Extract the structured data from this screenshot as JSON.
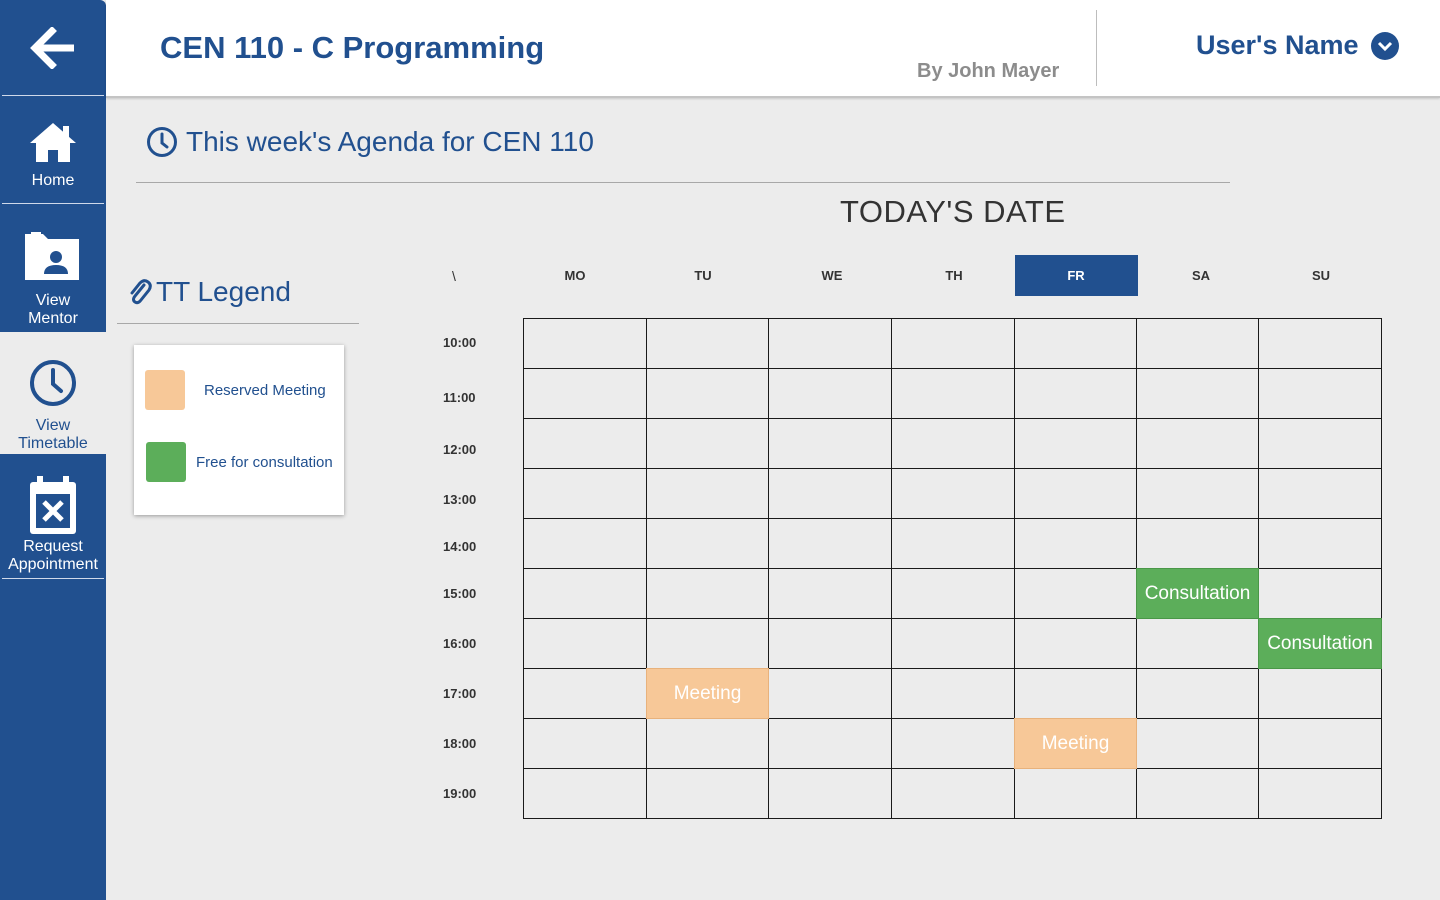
{
  "nav": {
    "back_icon": "arrow-left-icon",
    "items": [
      {
        "id": "home",
        "label": "Home",
        "icon": "home-icon"
      },
      {
        "id": "mentor",
        "label": "View\nMentor",
        "icon": "folder-user-icon"
      },
      {
        "id": "timetable",
        "label": "View\nTimetable",
        "icon": "clock-icon",
        "active": true
      },
      {
        "id": "appointment",
        "label": "Request\nAppointment",
        "icon": "calendar-x-icon"
      }
    ]
  },
  "header": {
    "course_title": "CEN 110 - C Programming",
    "author": "By John Mayer",
    "user_name": "User's Name"
  },
  "agenda": {
    "title": "This week's Agenda for CEN 110",
    "today_label": "TODAY'S DATE"
  },
  "legend": {
    "title": "TT Legend",
    "items": [
      {
        "label": "Reserved Meeting",
        "color": "#f7c898"
      },
      {
        "label": "Free for consultation",
        "color": "#5cae5a"
      }
    ]
  },
  "timetable": {
    "corner": "\\",
    "days": [
      "MO",
      "TU",
      "WE",
      "TH",
      "FR",
      "SA",
      "SU"
    ],
    "active_day": "FR",
    "times": [
      "10:00",
      "11:00",
      "12:00",
      "13:00",
      "14:00",
      "15:00",
      "16:00",
      "17:00",
      "18:00",
      "19:00"
    ],
    "events": [
      {
        "day": "SA",
        "time": "15:00",
        "label": "Consultation",
        "type": "consult"
      },
      {
        "day": "SU",
        "time": "16:00",
        "label": "Consultation",
        "type": "consult"
      },
      {
        "day": "TU",
        "time": "17:00",
        "label": "Meeting",
        "type": "meeting"
      },
      {
        "day": "FR",
        "time": "18:00",
        "label": "Meeting",
        "type": "meeting"
      }
    ]
  },
  "colors": {
    "primary": "#21508f",
    "meeting": "#f7c898",
    "consultation": "#5cae5a"
  }
}
